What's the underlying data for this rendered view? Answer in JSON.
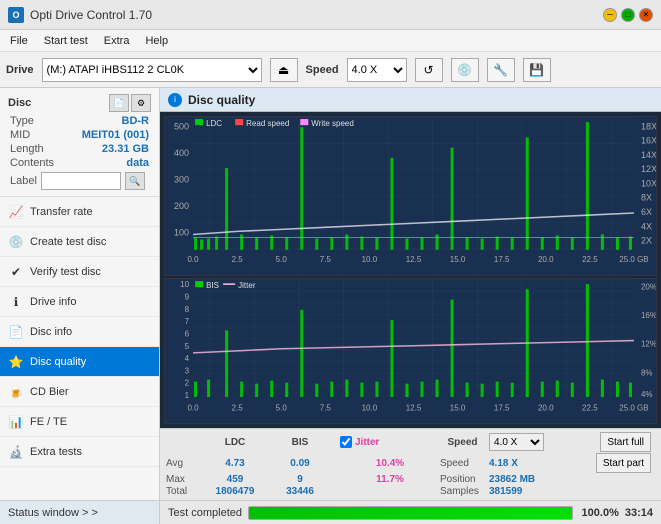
{
  "titleBar": {
    "title": "Opti Drive Control 1.70",
    "icon": "O"
  },
  "menuBar": {
    "items": [
      "File",
      "Start test",
      "Extra",
      "Help"
    ]
  },
  "driveBar": {
    "driveLabel": "Drive",
    "driveValue": "(M:) ATAPI iHBS112 2 CL0K",
    "speedLabel": "Speed",
    "speedValue": "4.0 X"
  },
  "sidebar": {
    "discSection": {
      "title": "Disc",
      "rows": [
        {
          "label": "Type",
          "value": "BD-R"
        },
        {
          "label": "MID",
          "value": "MEIT01 (001)"
        },
        {
          "label": "Length",
          "value": "23.31 GB"
        },
        {
          "label": "Contents",
          "value": "data"
        },
        {
          "label": "Label",
          "value": ""
        }
      ]
    },
    "navItems": [
      {
        "id": "transfer-rate",
        "label": "Transfer rate",
        "icon": "📈"
      },
      {
        "id": "create-test-disc",
        "label": "Create test disc",
        "icon": "💿"
      },
      {
        "id": "verify-test-disc",
        "label": "Verify test disc",
        "icon": "✔"
      },
      {
        "id": "drive-info",
        "label": "Drive info",
        "icon": "ℹ"
      },
      {
        "id": "disc-info",
        "label": "Disc info",
        "icon": "📄"
      },
      {
        "id": "disc-quality",
        "label": "Disc quality",
        "icon": "⭐",
        "active": true
      },
      {
        "id": "cd-bier",
        "label": "CD Bier",
        "icon": "🍺"
      },
      {
        "id": "fe-te",
        "label": "FE / TE",
        "icon": "📊"
      },
      {
        "id": "extra-tests",
        "label": "Extra tests",
        "icon": "🔬"
      }
    ]
  },
  "chartHeader": {
    "title": "Disc quality",
    "icon": "i"
  },
  "upperChart": {
    "legendItems": [
      {
        "color": "#00aa00",
        "label": "LDC"
      },
      {
        "color": "#ff4444",
        "label": "Read speed"
      },
      {
        "color": "#ff00ff",
        "label": "Write speed"
      }
    ],
    "yAxisLeft": [
      "500",
      "400",
      "300",
      "200",
      "100",
      "0"
    ],
    "yAxisRight": [
      "18X",
      "16X",
      "14X",
      "12X",
      "10X",
      "8X",
      "6X",
      "4X",
      "2X"
    ],
    "xAxis": [
      "0.0",
      "2.5",
      "5.0",
      "7.5",
      "10.0",
      "12.5",
      "15.0",
      "17.5",
      "20.0",
      "22.5",
      "25.0 GB"
    ]
  },
  "lowerChart": {
    "legendItems": [
      {
        "color": "#00aa00",
        "label": "BIS"
      },
      {
        "color": "#ffaa00",
        "label": "Jitter"
      }
    ],
    "yAxisLeft": [
      "10",
      "9",
      "8",
      "7",
      "6",
      "5",
      "4",
      "3",
      "2",
      "1"
    ],
    "yAxisRight": [
      "20%",
      "16%",
      "12%",
      "8%",
      "4%"
    ],
    "xAxis": [
      "0.0",
      "2.5",
      "5.0",
      "7.5",
      "10.0",
      "12.5",
      "15.0",
      "17.5",
      "20.0",
      "22.5",
      "25.0 GB"
    ]
  },
  "statsBar": {
    "headers": [
      "LDC",
      "BIS",
      "",
      "Jitter",
      "Speed",
      ""
    ],
    "rows": [
      {
        "label": "Avg",
        "ldc": "4.73",
        "bis": "0.09",
        "jitter": "10.4%"
      },
      {
        "label": "Max",
        "ldc": "459",
        "bis": "9",
        "jitter": "11.7%"
      },
      {
        "label": "Total",
        "ldc": "1806479",
        "bis": "33446",
        "jitter": ""
      }
    ],
    "speed": {
      "label": "Speed",
      "value": "4.18 X"
    },
    "speedSelect": "4.0 X",
    "position": {
      "label": "Position",
      "value": "23862 MB"
    },
    "samples": {
      "label": "Samples",
      "value": "381599"
    },
    "buttons": {
      "startFull": "Start full",
      "startPart": "Start part"
    }
  },
  "statusBar": {
    "statusWindowLabel": "Status window > >",
    "statusText": "Test completed",
    "progressPercent": "100.0%",
    "time": "33:14"
  }
}
